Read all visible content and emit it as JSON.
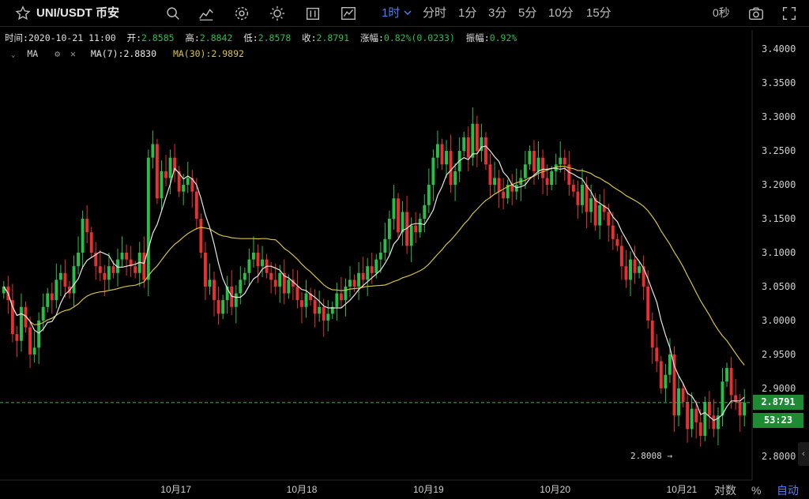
{
  "toolbar": {
    "symbol": "UNI/USDT 币安",
    "intervals": [
      "1时",
      "分时",
      "1分",
      "3分",
      "5分",
      "10分",
      "15分"
    ],
    "active_interval": "1时",
    "timer": "0秒",
    "icons": [
      "star-icon",
      "search-icon",
      "indicators-icon",
      "settings-icon",
      "theme-icon",
      "compare-icon",
      "chart-type-icon",
      "camera-icon",
      "fullscreen-icon"
    ]
  },
  "ohlc_bar": {
    "time_label": "时间:",
    "time_value": "2020-10-21 11:00",
    "open_label": "开:",
    "open_value": "2.8585",
    "high_label": "高:",
    "high_value": "2.8842",
    "low_label": "低:",
    "low_value": "2.8578",
    "close_label": "收:",
    "close_value": "2.8791",
    "change_label": "涨幅:",
    "change_value": "0.82%(0.0233)",
    "amp_label": "振幅:",
    "amp_value": "0.92%"
  },
  "ma_legend": {
    "name": "MA",
    "ma7": "MA(7):2.8830",
    "ma30": "MA(30):2.9892"
  },
  "price_tags": {
    "last_price": "2.8791",
    "countdown": "53:23",
    "low_marker": "2.8008 →"
  },
  "bottom": {
    "log_btn": "对数",
    "pct_btn": "%",
    "auto_btn": "自动"
  },
  "colors": {
    "up": "#26c048",
    "down": "#e8302f",
    "ma7": "#e6e6e6",
    "ma30": "#d6c23c",
    "last_line": "#26c048",
    "active": "#4f7df0"
  },
  "chart_data": {
    "type": "candlestick",
    "title": "UNI/USDT 币安",
    "interval": "1h",
    "x_ticks": [
      "10月17",
      "10月18",
      "10月19",
      "10月20",
      "10月21"
    ],
    "y_ticks": [
      "2.8000",
      "2.8500",
      "2.9000",
      "2.9500",
      "3.0000",
      "3.0500",
      "3.1000",
      "3.1500",
      "3.2000",
      "3.2500",
      "3.3000",
      "3.3500",
      "3.4000"
    ],
    "ylim": [
      2.78,
      3.42
    ],
    "grid": false,
    "last_price": 2.8791,
    "low_marker": 2.8008,
    "closes": [
      3.05,
      3.03,
      2.98,
      2.97,
      3.02,
      2.99,
      2.95,
      2.96,
      3.0,
      3.02,
      3.04,
      3.03,
      3.06,
      3.07,
      3.05,
      3.04,
      3.08,
      3.1,
      3.15,
      3.13,
      3.1,
      3.08,
      3.07,
      3.06,
      3.08,
      3.07,
      3.09,
      3.1,
      3.09,
      3.08,
      3.07,
      3.1,
      3.06,
      3.24,
      3.26,
      3.18,
      3.22,
      3.21,
      3.24,
      3.22,
      3.19,
      3.2,
      3.21,
      3.19,
      3.15,
      3.1,
      3.05,
      3.06,
      3.03,
      3.01,
      3.03,
      3.05,
      3.02,
      3.04,
      3.06,
      3.07,
      3.09,
      3.1,
      3.08,
      3.09,
      3.07,
      3.06,
      3.05,
      3.07,
      3.04,
      3.06,
      3.05,
      3.03,
      3.02,
      3.04,
      3.03,
      3.01,
      3.02,
      3.0,
      3.01,
      3.02,
      3.04,
      3.03,
      3.05,
      3.06,
      3.05,
      3.07,
      3.06,
      3.08,
      3.07,
      3.09,
      3.1,
      3.12,
      3.15,
      3.18,
      3.13,
      3.16,
      3.11,
      3.14,
      3.13,
      3.15,
      3.17,
      3.2,
      3.24,
      3.26,
      3.23,
      3.25,
      3.2,
      3.22,
      3.25,
      3.27,
      3.24,
      3.29,
      3.25,
      3.27,
      3.23,
      3.2,
      3.21,
      3.19,
      3.18,
      3.2,
      3.19,
      3.2,
      3.21,
      3.23,
      3.25,
      3.22,
      3.24,
      3.21,
      3.2,
      3.22,
      3.23,
      3.24,
      3.23,
      3.2,
      3.19,
      3.17,
      3.2,
      3.16,
      3.18,
      3.14,
      3.17,
      3.16,
      3.14,
      3.12,
      3.11,
      3.08,
      3.06,
      3.09,
      3.07,
      3.08,
      3.05,
      3.0,
      2.96,
      2.94,
      2.9,
      2.92,
      2.95,
      2.86,
      2.9,
      2.88,
      2.84,
      2.87,
      2.85,
      2.83,
      2.88,
      2.86,
      2.84,
      2.86,
      2.91,
      2.93,
      2.89,
      2.88,
      2.86,
      2.8791
    ],
    "ma7": "MA(7):2.8830",
    "ma30": "MA(30):2.9892"
  }
}
